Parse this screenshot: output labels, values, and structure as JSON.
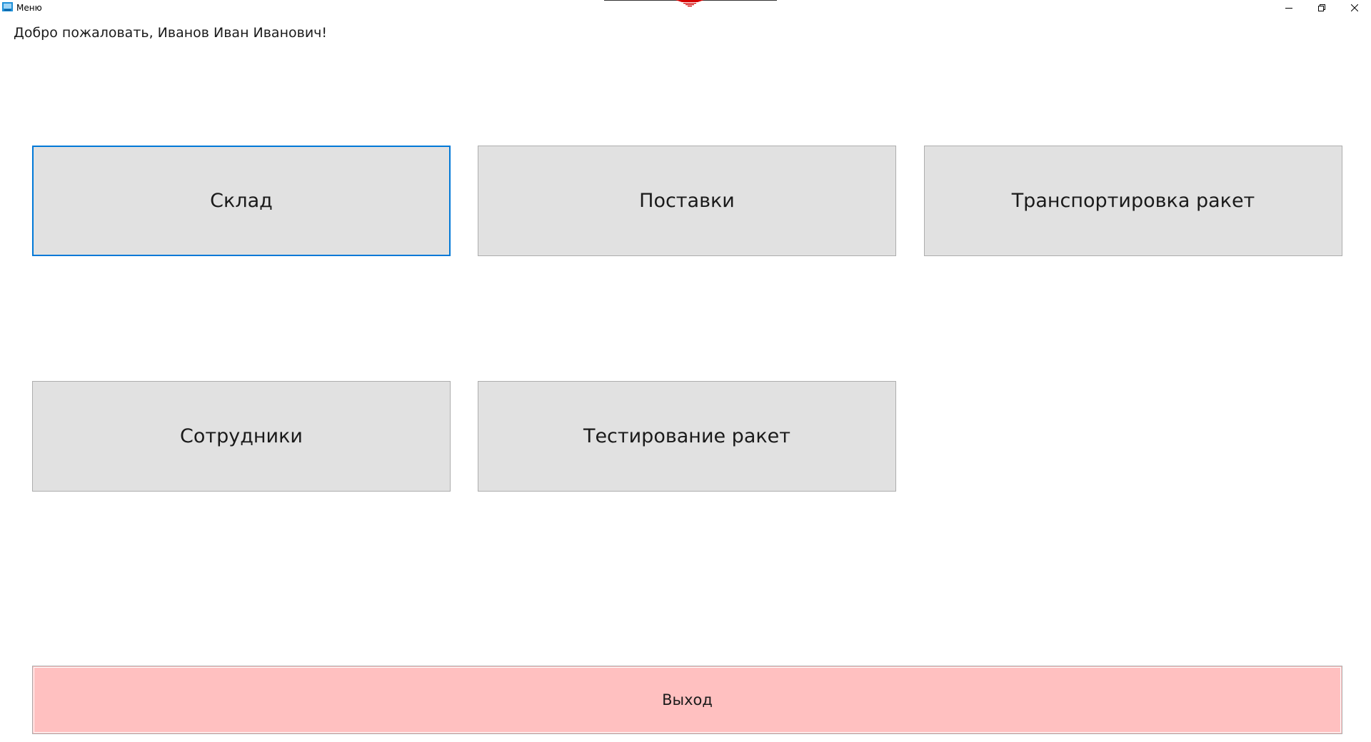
{
  "window": {
    "title": "Меню",
    "icon": "app-icon",
    "controls": [
      "minimize-icon",
      "restore-icon",
      "close-icon"
    ]
  },
  "greeting": "Добро пожаловать, Иванов Иван Иванович!",
  "menu": {
    "tiles": [
      {
        "label": "Склад",
        "focused": true
      },
      {
        "label": "Поставки",
        "focused": false
      },
      {
        "label": "Транспортировка ракет",
        "focused": false
      },
      {
        "label": "Сотрудники",
        "focused": false
      },
      {
        "label": "Тестирование ракет",
        "focused": false
      }
    ],
    "exit_label": "Выход"
  },
  "colors": {
    "tile_bg": "#e1e1e1",
    "tile_border": "#adadad",
    "focus_border": "#0078d7",
    "exit_bg": "#ffc0c0",
    "title_decoration": "#d40000"
  }
}
